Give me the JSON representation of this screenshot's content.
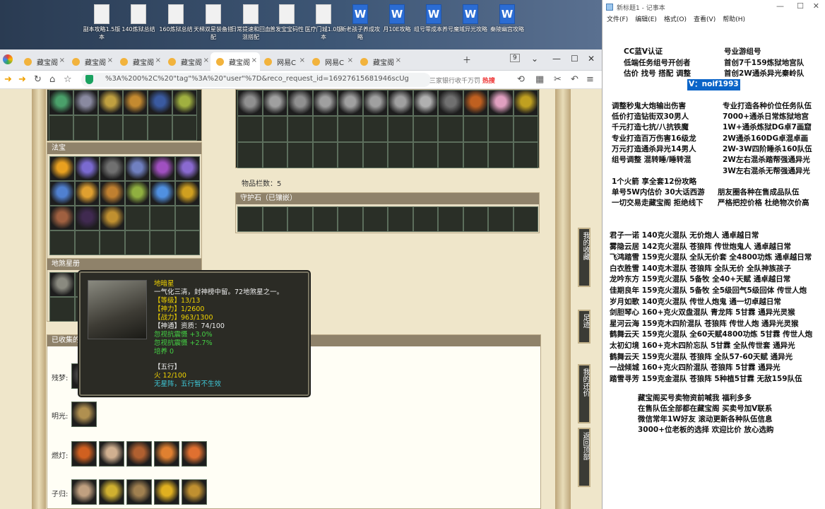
{
  "desktop_icons": [
    {
      "label": "副本攻略1.5版本",
      "type": "doc"
    },
    {
      "label": "140炼狱总结",
      "type": "doc"
    },
    {
      "label": "160炼狱总结",
      "type": "doc"
    },
    {
      "label": "天梯双星装备搭配",
      "type": "doc"
    },
    {
      "label": "日常提速和回血混搭配",
      "type": "doc"
    },
    {
      "label": "普发宝宝码性",
      "type": "doc"
    },
    {
      "label": "医疗门城1.0版本",
      "type": "doc"
    },
    {
      "label": "新老孩子养成攻略",
      "type": "word"
    },
    {
      "label": "月10E攻略",
      "type": "word"
    },
    {
      "label": "组号零成本养号",
      "type": "word"
    },
    {
      "label": "魔域异光攻略",
      "type": "word"
    },
    {
      "label": "秦陵幽宫攻略",
      "type": "word"
    }
  ],
  "browser": {
    "tabs": [
      "藏宝阁",
      "藏宝阁",
      "藏宝阁",
      "藏宝阁",
      "藏宝阁",
      "网易C",
      "网易C",
      "藏宝阁"
    ],
    "url": "%3A%200%2C%20\"tag\"%3A%20\"user\"%7D&reco_request_id=16927615681946scUg",
    "search_placeholder": "三家银行收千万罚",
    "search_badge": "热搜",
    "tab_count": "9"
  },
  "game": {
    "fabao_title": "法宝",
    "disha_title": "地煞星册",
    "item_count_label": "物品栏数：5",
    "guard_stone_title": "守护石（已镶嵌）",
    "collected_title": "已收集的",
    "rows": [
      {
        "label": "残梦:"
      },
      {
        "label": "明光:"
      },
      {
        "label": "燃灯:"
      },
      {
        "label": "子归:"
      }
    ],
    "side_buttons": [
      "我的收藏",
      "足迹",
      "我的还价",
      "返回顶部"
    ]
  },
  "tooltip": {
    "name": "地暗星",
    "desc": "一气化三清，封神榜中留。72地煞星之一。",
    "level": "【等级】13/13",
    "power": "【神力】1/2600",
    "combat": "【战力】963/1300",
    "aptitude": "【神通】资质：74/100",
    "bonus1": "忽视抗震慑 +3.0%",
    "bonus2": "忽视抗震慑 +2.7%",
    "cultivation": "培养 0",
    "wuxing_title": "【五行】",
    "wuxing_fire": "火 12/100",
    "wuxing_note": "无星阵，五行暂不生效"
  },
  "notepad": {
    "title": "新标题1 - 记事本",
    "menu": [
      "文件(F)",
      "编辑(E)",
      "格式(O)",
      "查看(V)",
      "帮助(H)"
    ],
    "header_lines": [
      {
        "l": "CC蓝V认证",
        "r": "号业游组号"
      },
      {
        "l": "低端任务组号开创者",
        "r": "首创7千159炼狱地宫队"
      },
      {
        "l": "估价 找号 搭配 调整",
        "r": "首创2W通杀异光秦岭队"
      }
    ],
    "contact": "V：noif1993",
    "service_lines": [
      {
        "l": "调整秒鬼大炮输出伤害",
        "r": "专业打造各种价位任务队伍"
      },
      {
        "l": "低价打造钻街双30男人",
        "r": "7000+通杀日常炼狱地宫"
      },
      {
        "l": "千元打造七抗/八抗铁魔",
        "r": "1W+通杀炼狱DG卓7画窟"
      },
      {
        "l": "专业打造百万伤害16级龙",
        "r": "2W通杀160DG卓混卓画"
      },
      {
        "l": "万元打造通杀异光14男人",
        "r": "2W-3W四阶睡杀160队伍"
      },
      {
        "l": "组号调整 混转睡/睡转混",
        "r": "2W左右混杀踏帮强通异光"
      },
      {
        "l": "",
        "r": "3W左右混杀无帮强通异光"
      }
    ],
    "mid_lines": [
      {
        "l": "1个火箭 享全套12份攻略",
        "r": ""
      },
      {
        "l": "单号5W内估价 30大话西游",
        "r": "朋友圈各种在售成品队伍"
      },
      {
        "l": "一切交易走藏宝阁 拒绝线下",
        "r": "严格把控价格 杜绝物次价高"
      }
    ],
    "list_lines": [
      "君子一诺 140克火混队 无价炮人 通卓越日常",
      "雾隐云居 142克火混队 苍狼阵 传世炮鬼人 通卓越日常",
      "飞鸿踏雪 159克火混队 全队无价套 全4800功炼 通卓越日常",
      "白衣胜雪 140克木混队 苍狼阵 全队无价 全队神族孩子",
      "龙吟东方 159克火混队 5备牧 全40+天赋 通卓越日常",
      "佳期良年 159克火混队 5备牧 全5级回气5级回体 传世人炮",
      "岁月如歌 140克火混队 传世人炮鬼 通一切卓越日常",
      "剑胆琴心 160+克火双盘混队 青龙阵 5甘霖 通异光灵猴",
      "星河云海 159克木四阶混队 苍狼阵 传世人炮 通异光灵猴",
      "鹤舞云天 159克火混队 全60天赋4800功炼 5甘霖 传世人炮",
      "太初幻境 160+克木四阶忘队 5甘霖 全队传世套 通异光",
      "鹤舞云天 159克火混队 苍狼阵 全队57-60天赋 通异光",
      "一战倾城 160+克火四阶混队 苍狼阵 5甘霖 通异光",
      "踏雪寻芳 159克金混队 苍狼阵 5种植5甘霖 无敌159队伍"
    ],
    "footer_lines": [
      "藏宝阁买号卖物资前喊我 福利多多",
      "在售队伍全部都在藏宝阁 买卖号加V联系",
      "微信常年1W好友 滚动更新各种队伍信息",
      "3000+位老板的选择 欢迎比价 放心选购"
    ]
  },
  "colors": {
    "selection": "#0a64c8",
    "tooltip_bg": "#2b2b25",
    "frame": "#bda67a"
  }
}
